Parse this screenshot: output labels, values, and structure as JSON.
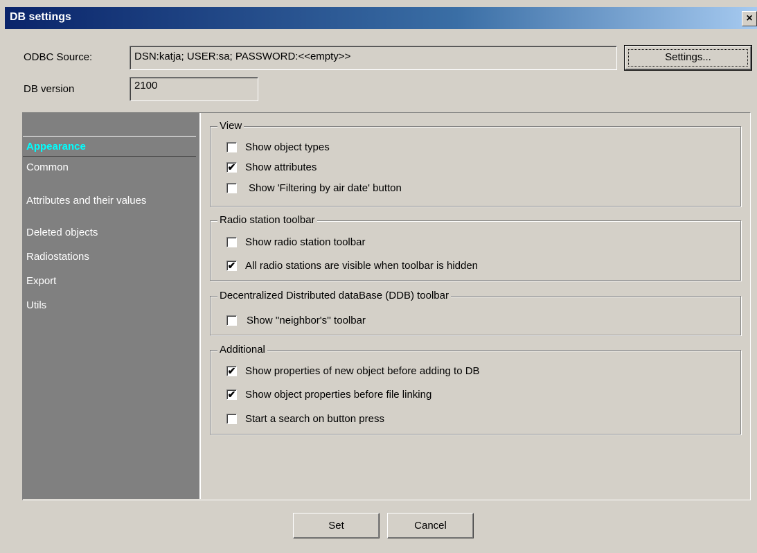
{
  "window": {
    "title": "DB settings",
    "close_glyph": "×"
  },
  "odbc": {
    "label": "ODBC Source:",
    "value": "DSN:katja; USER:sa; PASSWORD:<<empty>>",
    "settings_button": "Settings..."
  },
  "dbversion": {
    "label": "DB version",
    "value": "2100"
  },
  "nav": {
    "items": [
      "Appearance",
      "Common",
      "Attributes and their values",
      "Deleted objects",
      "Radiostations",
      "Export",
      "Utils"
    ],
    "active": "Appearance"
  },
  "groups": {
    "view": {
      "title": "View",
      "options": [
        {
          "label": "Show object types",
          "checked": false
        },
        {
          "label": "Show attributes",
          "checked": true
        },
        {
          "label": "Show 'Filtering by air date' button",
          "checked": false
        }
      ]
    },
    "radio": {
      "title": "Radio station toolbar",
      "options": [
        {
          "label": "Show radio station toolbar",
          "checked": false
        },
        {
          "label": "All radio stations are visible when toolbar is hidden",
          "checked": true
        }
      ]
    },
    "ddb": {
      "title": "Decentralized Distributed dataBase (DDB) toolbar",
      "options": [
        {
          "label": "Show ''neighbor's'' toolbar",
          "checked": false
        }
      ]
    },
    "additional": {
      "title": "Additional",
      "options": [
        {
          "label": "Show properties of new object before adding to DB",
          "checked": true
        },
        {
          "label": "Show object properties before file linking",
          "checked": true
        },
        {
          "label": "Start a search on button press",
          "checked": false
        }
      ]
    }
  },
  "footer": {
    "set_label": "Set",
    "cancel_label": "Cancel"
  },
  "colors": {
    "face": "#d4d0c8",
    "nav_bg": "#808080",
    "nav_active_text": "#00ffff",
    "title_bg": "#0a246a"
  },
  "icons": {
    "close": "close-icon",
    "check": "checkmark-icon"
  },
  "check_glyph": "✔"
}
